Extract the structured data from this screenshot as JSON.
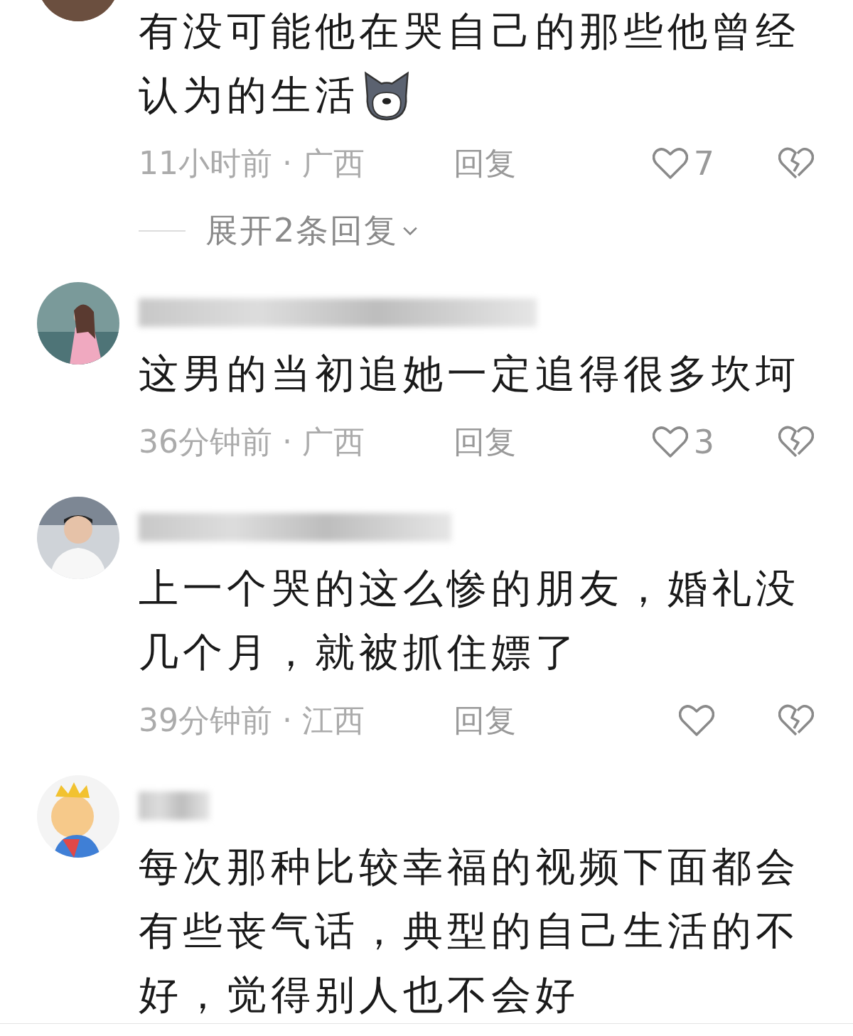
{
  "comments": [
    {
      "kind": "continued",
      "lines": [
        "有没可能他在哭自己的那些他曾经",
        "认为的生活"
      ],
      "sticker": true,
      "time": "11小时前",
      "sep": "·",
      "region": "广西",
      "reply": "回复",
      "likes": "7",
      "expand": {
        "label": "展开2条回复"
      }
    },
    {
      "kind": "comment",
      "name_hidden": true,
      "lines": [
        "这男的当初追她一定追得很多坎坷"
      ],
      "sticker": false,
      "time": "36分钟前",
      "sep": "·",
      "region": "广西",
      "reply": "回复",
      "likes": "3"
    },
    {
      "kind": "comment",
      "name_hidden": true,
      "lines": [
        "上一个哭的这么惨的朋友，婚礼没",
        "几个月，就被抓住嫖了"
      ],
      "sticker": false,
      "time": "39分钟前",
      "sep": "·",
      "region": "江西",
      "reply": "回复"
    },
    {
      "kind": "comment",
      "name_hidden": true,
      "lines": [
        "每次那种比较幸福的视频下面都会",
        "有些丧气话，典型的自己生活的不",
        "好，觉得别人也不会好"
      ],
      "sticker": false
    }
  ]
}
